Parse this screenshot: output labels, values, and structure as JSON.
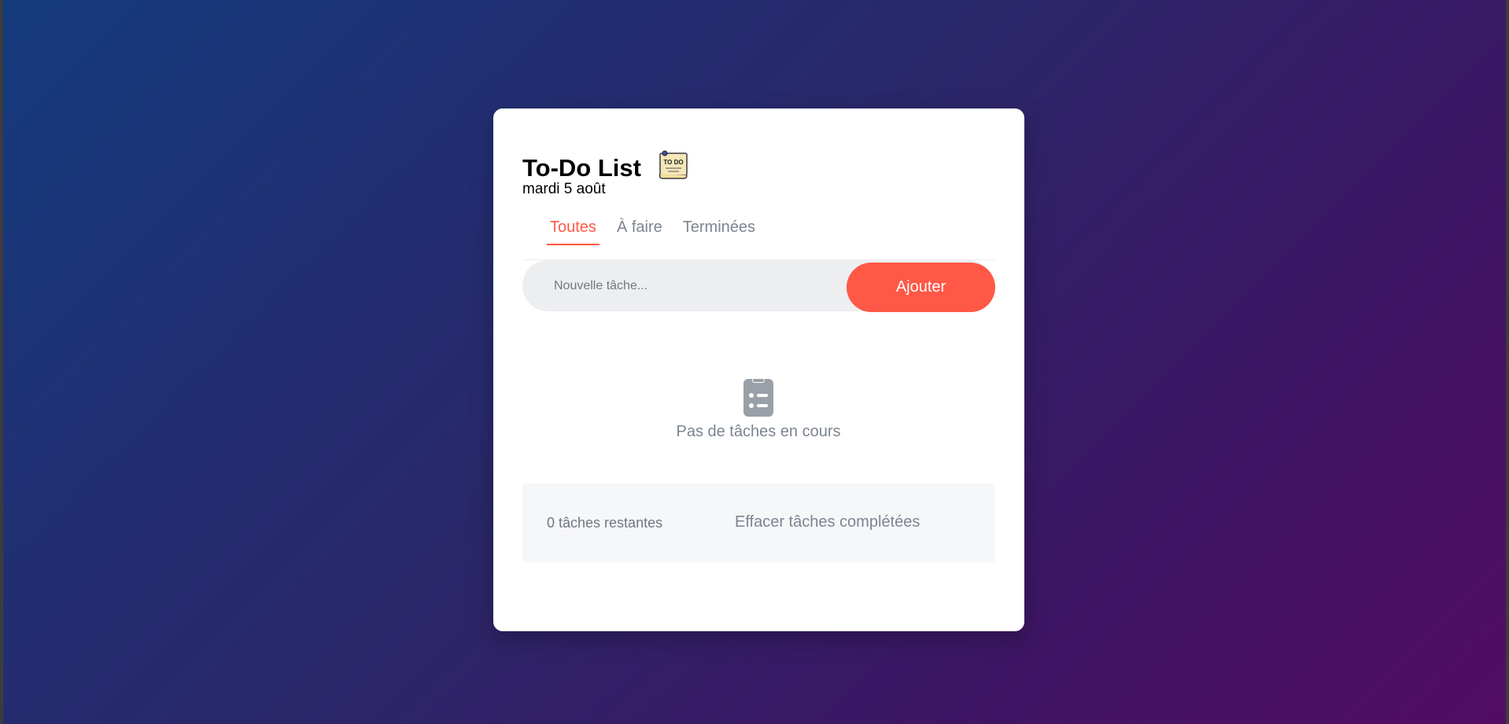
{
  "header": {
    "title": "To-Do List",
    "icon": "todo-note-icon",
    "date": "mardi 5 août"
  },
  "tabs": [
    {
      "label": "Toutes",
      "active": true
    },
    {
      "label": "À faire",
      "active": false
    },
    {
      "label": "Terminées",
      "active": false
    }
  ],
  "new_task": {
    "placeholder": "Nouvelle tâche...",
    "value": "",
    "add_label": "Ajouter"
  },
  "empty_state": {
    "icon": "clipboard-list-icon",
    "message": "Pas de tâches en cours"
  },
  "footer": {
    "remaining": "0 tâches restantes",
    "clear_label": "Effacer tâches complétées"
  },
  "colors": {
    "accent": "#ff5846",
    "muted_text": "#7c8591",
    "background_start": "#143a7e",
    "background_end": "#530d62"
  }
}
